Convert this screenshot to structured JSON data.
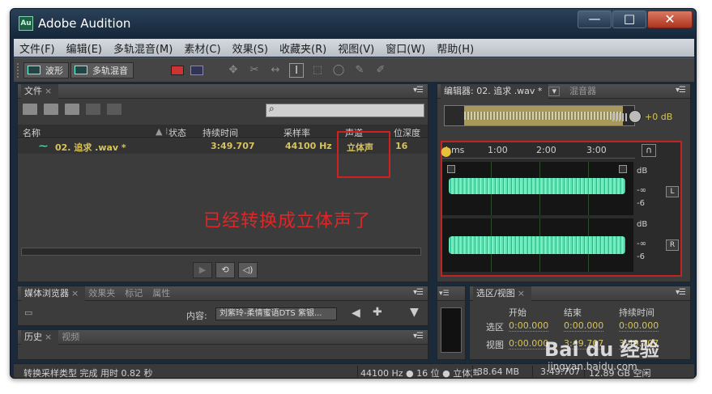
{
  "window": {
    "title": "Adobe Audition",
    "app_icon_text": "Au"
  },
  "window_controls": {
    "minimize": "—",
    "maximize": "□",
    "close": "✕"
  },
  "menu": [
    "文件(F)",
    "编辑(E)",
    "多轨混音(M)",
    "素材(C)",
    "效果(S)",
    "收藏夹(R)",
    "视图(V)",
    "窗口(W)",
    "帮助(H)"
  ],
  "toolbar": {
    "waveform_label": "波形",
    "multitrack_label": "多轨混音"
  },
  "files_panel": {
    "tab": "文件",
    "columns": [
      "名称",
      "状态",
      "持续时间",
      "采样率",
      "声道",
      "位深度"
    ],
    "row": {
      "name": "02. 追求 .wav *",
      "duration": "3:49.707",
      "sample_rate": "44100 Hz",
      "channels": "立体声",
      "bit_depth": "16"
    }
  },
  "annotation": "已经转换成立体声了",
  "editor_panel": {
    "tab": "编辑器: 02. 追求 .wav *",
    "tab2": "混音器",
    "volume": "+0 dB",
    "ruler": [
      "hms",
      "1:00",
      "2:00",
      "3:00"
    ],
    "db_labels": {
      "db": "dB",
      "neg_inf": "-∞",
      "neg6": "-6"
    },
    "channel_left": "L",
    "channel_right": "R"
  },
  "browser_panel": {
    "tabs": [
      "媒体浏览器",
      "效果夹",
      "标记",
      "属性"
    ],
    "content_label": "内容:",
    "content_value": "刘紫玲-柔情蜜语DTS 紫银..."
  },
  "history_panel": {
    "tabs": [
      "历史",
      "视频"
    ]
  },
  "selection_panel": {
    "tab": "选区/视图",
    "headers": [
      "开始",
      "结束",
      "持续时间"
    ],
    "rows": [
      {
        "label": "选区",
        "start": "0:00.000",
        "end": "0:00.000",
        "duration": "0:00.000"
      },
      {
        "label": "视图",
        "start": "0:00.000",
        "end": "3:49.707",
        "duration": "3:49.707"
      }
    ]
  },
  "status": {
    "message": "转换采样类型 完成 用时 0.82 秒",
    "format": "44100 Hz ● 16 位 ● 立体声",
    "size": "38.64 MB",
    "duration": "3:49.707",
    "free": "12.89 GB 空闲"
  },
  "watermark": {
    "brand": "Bai du 经验",
    "url": "jingyan.baidu.com"
  }
}
